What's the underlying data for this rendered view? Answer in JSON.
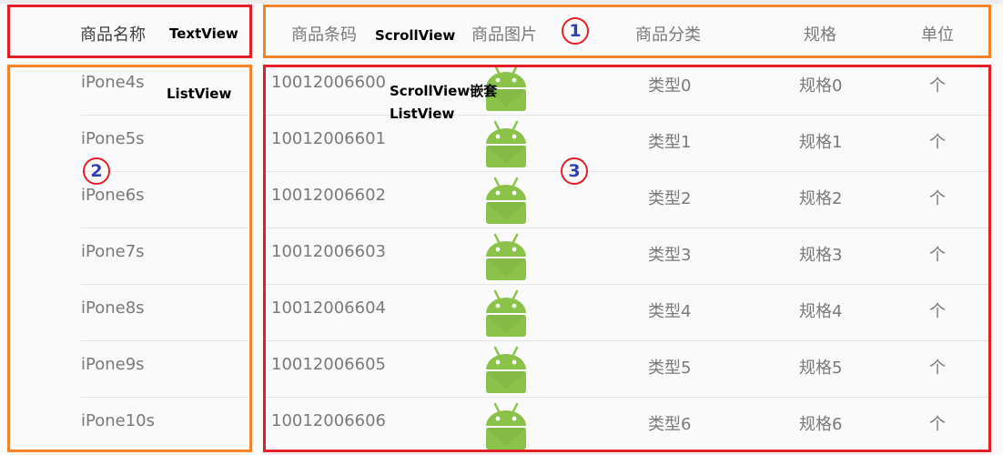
{
  "header": {
    "name": "商品名称",
    "columns": [
      "商品条码",
      "商品图片",
      "商品分类",
      "规格",
      "单位"
    ]
  },
  "rows": [
    {
      "name": "iPone4s",
      "code": "10012006600",
      "type": "类型0",
      "spec": "规格0",
      "unit": "个"
    },
    {
      "name": "iPone5s",
      "code": "10012006601",
      "type": "类型1",
      "spec": "规格1",
      "unit": "个"
    },
    {
      "name": "iPone6s",
      "code": "10012006602",
      "type": "类型2",
      "spec": "规格2",
      "unit": "个"
    },
    {
      "name": "iPone7s",
      "code": "10012006603",
      "type": "类型3",
      "spec": "规格3",
      "unit": "个"
    },
    {
      "name": "iPone8s",
      "code": "10012006604",
      "type": "类型4",
      "spec": "规格4",
      "unit": "个"
    },
    {
      "name": "iPone9s",
      "code": "10012006605",
      "type": "类型5",
      "spec": "规格5",
      "unit": "个"
    },
    {
      "name": "iPone10s",
      "code": "10012006606",
      "type": "类型6",
      "spec": "规格6",
      "unit": "个"
    }
  ],
  "annotations": {
    "textview": "TextView",
    "scrollview": "ScrollView",
    "listview": "ListView",
    "nested_line1": "ScrollView嵌套",
    "nested_line2": "ListView",
    "marker1": "1",
    "marker2": "2",
    "marker3": "3"
  },
  "colors": {
    "android_green": "#8bc34a",
    "red_box": "#e3202a",
    "orange_box": "#f2852b",
    "marker_text": "#3441b3"
  },
  "icons": [
    "android-icon"
  ]
}
